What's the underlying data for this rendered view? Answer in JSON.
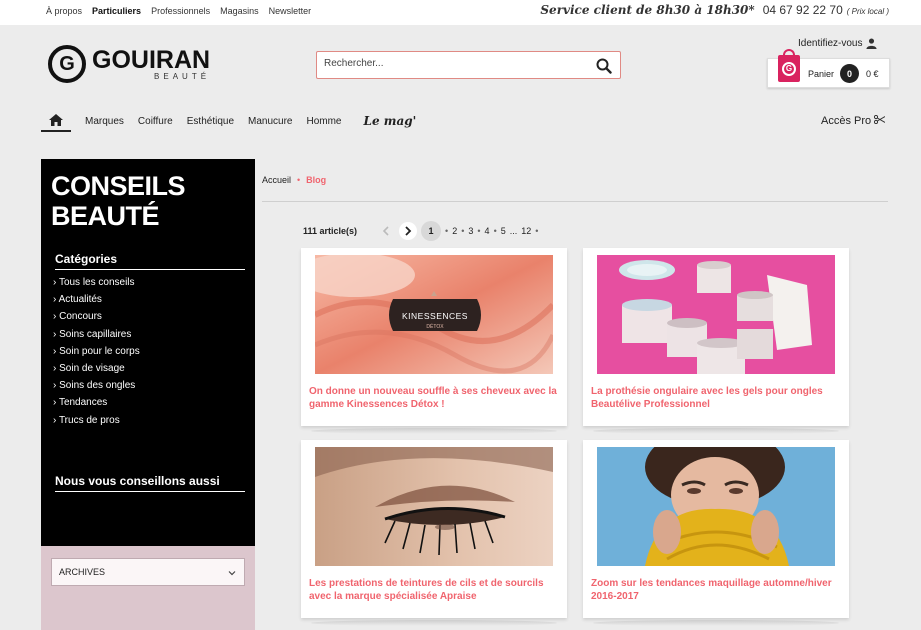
{
  "topbar": {
    "links": [
      "À propos",
      "Particuliers",
      "Professionnels",
      "Magasins",
      "Newsletter"
    ],
    "active_index": 1,
    "service": "Service client de 8h30 à 18h30*",
    "phone": "04 67 92 22 70",
    "price_note": "( Prix local )"
  },
  "header": {
    "logo_name": "GOUIRAN",
    "logo_sub": "BEAUTÉ",
    "search_placeholder": "Rechercher...",
    "identify": "Identifiez-vous",
    "cart_label": "Panier",
    "cart_count": "0",
    "cart_total": "0 €"
  },
  "nav": {
    "items": [
      "Marques",
      "Coiffure",
      "Esthétique",
      "Manucure",
      "Homme"
    ],
    "mag": "Le mag'",
    "pro": "Accès Pro"
  },
  "sidebar": {
    "title_line1": "CONSEILS",
    "title_line2": "BEAUTÉ",
    "categories_heading": "Catégories",
    "categories": [
      "Tous les conseils",
      "Actualités",
      "Concours",
      "Soins capillaires",
      "Soin pour le corps",
      "Soin de visage",
      "Soins des ongles",
      "Tendances",
      "Trucs de pros"
    ],
    "advice_heading": "Nous vous conseillons aussi",
    "archives_label": "ARCHIVES"
  },
  "breadcrumb": {
    "home": "Accueil",
    "current": "Blog"
  },
  "pager": {
    "count": "111 article(s)",
    "pages": [
      "1",
      "2",
      "3",
      "4",
      "5",
      "...",
      "12"
    ],
    "active": "1"
  },
  "articles": [
    {
      "title": "On donne un nouveau souffle à ses cheveux avec la gamme Kinessences Détox !",
      "badge_text": "KINESSENCES",
      "badge_sub": "DÉTOX"
    },
    {
      "title": "La prothésie ongulaire avec les gels pour ongles Beautélive Professionnel"
    },
    {
      "title": "Les prestations de teintures de cils et de sourcils avec la marque spécialisée Apraise"
    },
    {
      "title": "Zoom sur les tendances maquillage automne/hiver 2016-2017"
    }
  ],
  "colors": {
    "accent": "#f0646e",
    "cart_bag": "#d9235f",
    "sidebar_bg": "#000000",
    "archive_bg": "#dcc6cd"
  }
}
